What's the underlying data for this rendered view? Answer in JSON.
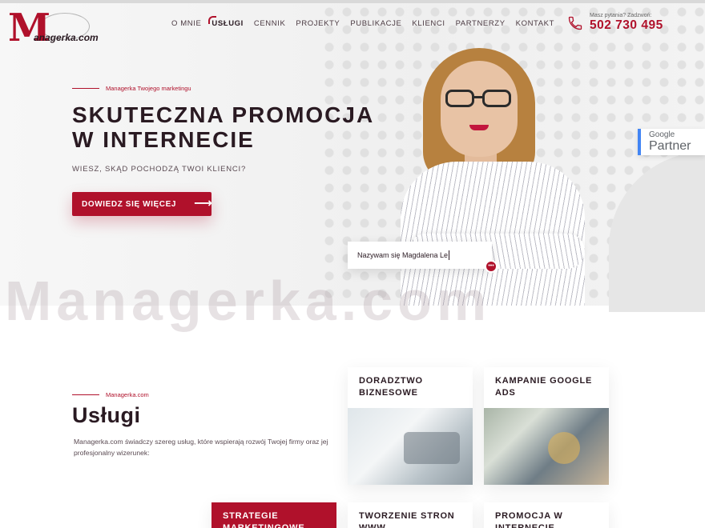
{
  "header": {
    "logo_text": "anagerka.com",
    "logo_letter": "M",
    "nav": [
      {
        "label": "O mnie",
        "active": false
      },
      {
        "label": "Usługi",
        "active": true
      },
      {
        "label": "Cennik",
        "active": false
      },
      {
        "label": "Projekty",
        "active": false
      },
      {
        "label": "Publikacje",
        "active": false
      },
      {
        "label": "Klienci",
        "active": false
      },
      {
        "label": "Partnerzy",
        "active": false
      },
      {
        "label": "Kontakt",
        "active": false
      }
    ],
    "phone_question": "Masz pytania? Zadzwoń:",
    "phone_number": "502 730 495",
    "phone_icon": "phone-icon"
  },
  "hero": {
    "eyebrow": "Managerka Twojego marketingu",
    "title_line1": "SKUTECZNA PROMOCJA",
    "title_line2": "W INTERNECIE",
    "subtitle": "Wiesz, skąd pochodzą Twoi klienci?",
    "cta_label": "Dowiedz się więcej",
    "cta_icon": "arrow-right-icon",
    "chat_text": "Nazywam się Magdalena Le",
    "google_top": "Google",
    "google_bottom": "Partner",
    "watermark": "Managerka.com"
  },
  "services": {
    "eyebrow": "Managerka.com",
    "title": "Usługi",
    "description": "Managerka.com świadczy szereg usług, które wspierają rozwój Twojej firmy oraz jej profesjonalny wizerunek:",
    "cards": [
      {
        "title": "Doradztwo biznesowe"
      },
      {
        "title": "Kampanie Google Ads"
      },
      {
        "title": "Strategie marketingowe"
      },
      {
        "title": "Tworzenie stron www"
      },
      {
        "title": "Promocja w internecie"
      }
    ]
  },
  "colors": {
    "accent": "#b0112b",
    "text": "#2a1a22"
  }
}
